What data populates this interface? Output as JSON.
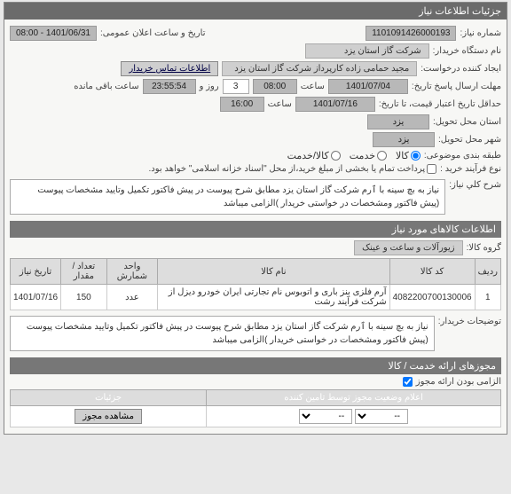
{
  "header": {
    "title": "جزئیات اطلاعات نیاز"
  },
  "fields": {
    "need_number_label": "شماره نیاز:",
    "need_number": "1101091426000193",
    "announce_label": "تاریخ و ساعت اعلان عمومی:",
    "announce_value": "1401/06/31 - 08:00",
    "buyer_org_label": "نام دستگاه خریدار:",
    "buyer_org": "شرکت گاز استان یزد",
    "creator_label": "ایجاد کننده درخواست:",
    "creator": "مجید حمامی زاده کارپرداز شرکت گاز استان یزد",
    "contact_link": "اطلاعات تماس خریدار",
    "send_deadline_label": "مهلت ارسال پاسخ تاریخ:",
    "send_date": "1401/07/04",
    "hour_label": "ساعت",
    "send_hour": "08:00",
    "days_label": "روز و",
    "days_value": "3",
    "remain_time": "23:55:54",
    "remain_label": "ساعت باقی مانده",
    "validity_label": "حداقل تاریخ اعتبار قیمت، تا تاریخ:",
    "validity_date": "1401/07/16",
    "validity_hour": "16:00",
    "delivery_place_label": "استان محل تحویل:",
    "delivery_province": "یزد",
    "delivery_city_label": "شهر محل تحویل:",
    "delivery_city": "یزد",
    "budget_label": "طبقه بندی موضوعی:",
    "budget_opt_goods": "کالا",
    "budget_opt_service": "خدمت",
    "budget_opt_both": "کالا/خدمت",
    "pay_label": "نوع فرآیند خرید :",
    "pay_note": "پرداخت تمام یا بخشی از مبلغ خرید،از محل \"اسناد خزانه اسلامی\" خواهد بود.",
    "desc_label": "شرح کلي نياز:",
    "desc_text": "نیاز به بچ سینه با ٱرم شرکت گاز استان یزد مطابق شرح پیوست در پیش فاکتور تکمیل وتایید مشخصات پیوست (پیش فاکتور ومشخصات در خواستی خریدار )الزامی میباشد"
  },
  "items_section": {
    "title": "اطلاعات کالاهای مورد نیاز",
    "group_label": "گروه کالا:",
    "group_value": "زیورآلات و ساعت و عینک",
    "table": {
      "headers": [
        "ردیف",
        "کد کالا",
        "نام کالا",
        "واحد شمارش",
        "تعداد / مقدار",
        "تاریخ نیاز"
      ],
      "rows": [
        {
          "idx": "1",
          "code": "4082200700130006",
          "name": "آرم فلزی بنز باری و اتوبوس نام تجارتی ایران خودرو دیزل از شرکت فرآیند رشت",
          "unit": "عدد",
          "qty": "150",
          "date": "1401/07/16"
        }
      ]
    },
    "buyer_note_label": "توضیحات خریدار:",
    "buyer_note": "نیاز به بچ سینه با ٱرم شرکت گاز استان یزد مطابق شرح پیوست در پیش فاکتور تکمیل وتایید مشخصات پیوست (پیش فاکتور ومشخصات در خواستی خریدار )الزامی میباشد"
  },
  "permits_section": {
    "title": "مجوزهای ارائه خدمت / کالا",
    "mandatory_label": "الزامی بودن ارائه مجوز",
    "status_header": "اعلام وضعیت مجوز توسط تامین کننده",
    "details_header": "جزئیات",
    "select_placeholder": "--",
    "view_btn": "مشاهده مجوز"
  }
}
